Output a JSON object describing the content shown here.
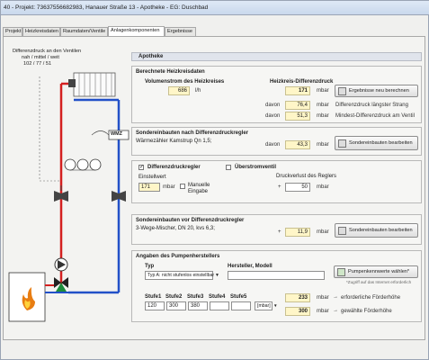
{
  "window": {
    "title": "40 - Projekt: 736375566829​83, Hanauer Straße 13 - Apotheke    - EG: Duschbad"
  },
  "tabs": [
    {
      "label": "Projekt"
    },
    {
      "label": "Heizkreisdaten"
    },
    {
      "label": "Raumdaten/Ventile"
    },
    {
      "label": "Anlagenkomponenten"
    },
    {
      "label": "Ergebnisse"
    }
  ],
  "left": {
    "diff_label_line1": "Differenzdruck an den Ventilen",
    "diff_label_line2": "nah / mittel / weit",
    "diff_values": "102 / 77 / 51",
    "wmz_label": "WMZ"
  },
  "header": {
    "title": "Apotheke"
  },
  "berechnete": {
    "title": "Berechnete Heizkreisdaten",
    "volumenstrom_label": "Volumenstrom des Heizkreises",
    "volumenstrom_value": "686",
    "volumenstrom_unit": "l/h",
    "hk_diff_label": "Heizkreis-Differenzdruck",
    "hk_diff_value": "171",
    "hk_diff_unit": "mbar",
    "recalc_button": "Ergebnisse neu berechnen",
    "davon1": "davon",
    "value_strang": "76,4",
    "unit_strang": "mbar",
    "label_strang": "Differenzdruck längster Strang",
    "davon2": "davon",
    "value_ventil": "51,3",
    "unit_ventil": "mbar",
    "label_ventil": "Mindest-Differenzdruck am Ventil"
  },
  "sondereinbauten_nach": {
    "title": "Sondereinbauten nach Differenzdruckregler",
    "text": "Wärmezähler Kamstrup Qn 1,5;",
    "davon": "davon",
    "value": "43,3",
    "unit": "mbar",
    "button": "Sondereinbauten bearbeiten"
  },
  "regler": {
    "diff_check_label": "Differenzdruckregler",
    "diff_checked": "✓",
    "ueber_check_label": "Überstromventil",
    "einstellwert_label": "Einstellwert",
    "einstellwert_value": "171",
    "einstellwert_unit": "mbar",
    "manuelle_label_1": "Manuelle",
    "manuelle_label_2": "Eingabe",
    "druckverlust_label": "Druckverlust des Reglers",
    "druckverlust_value": "50",
    "druckverlust_unit": "mbar",
    "plus": "+"
  },
  "sondereinbauten_vor": {
    "title": "Sondereinbauten vor Differenzdruckregler",
    "text": "3-Wege-Mischer, DN 20, kvs 6,3;",
    "plus": "+",
    "value": "11,9",
    "unit": "mbar",
    "button": "Sondereinbauten bearbeiten"
  },
  "pumpen": {
    "title": "Angaben des Pumpenherstellers",
    "typ_label": "Typ",
    "typ_value": "Typ A: nicht stufenlos einstellbar",
    "hersteller_label": "Hersteller, Modell",
    "button": "Pumpenkennwerte wählen*",
    "note": "*Zugriff auf das Internet erforderlich",
    "stufen": [
      "Stufe1",
      "Stufe2",
      "Stufe3",
      "Stufe4",
      "Stufe5"
    ],
    "stufen_values": [
      "120",
      "300",
      "380",
      "",
      ""
    ],
    "unit_select": "[mbar]",
    "value1": "233",
    "unit1": "mbar",
    "label1": "erforderliche Förderhöhe",
    "value2": "300",
    "unit2": "mbar",
    "label2": "gewählte Förderhöhe",
    "arrow": "→"
  }
}
